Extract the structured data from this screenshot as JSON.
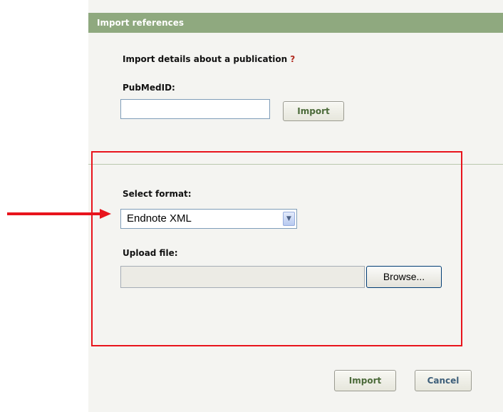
{
  "header": {
    "title": "Import references"
  },
  "pubmed_section": {
    "heading": "Import details about a publication",
    "help_mark": "?",
    "pubmed_label": "PubMedID:",
    "pubmed_value": "",
    "import_button": "Import"
  },
  "file_section": {
    "format_label": "Select format:",
    "format_selected": "Endnote XML",
    "upload_label": "Upload file:",
    "browse_button": "Browse..."
  },
  "footer": {
    "import_button": "Import",
    "cancel_button": "Cancel"
  },
  "colors": {
    "header_bg": "#8fa97f",
    "panel_bg": "#f4f4f1",
    "annotation_red": "#e8141c",
    "button_text_green": "#4b6a39",
    "help_mark_red": "#b1291e"
  }
}
